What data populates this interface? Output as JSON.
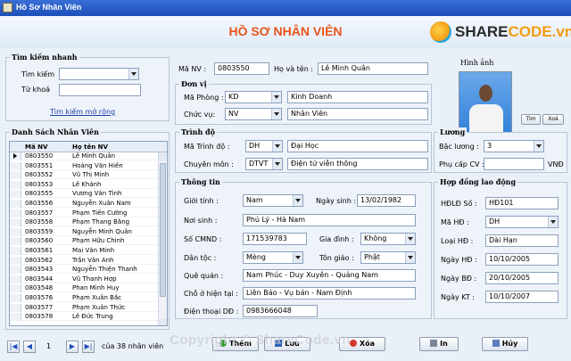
{
  "window": {
    "title": "Hồ Sơ Nhân Viên"
  },
  "header": {
    "title": "HỒ SƠ NHÂN VIÊN"
  },
  "logo": {
    "text_part1": "SHARE",
    "text_part2": "CODE.vn"
  },
  "search": {
    "group_title": "Tìm kiếm nhanh",
    "find_label": "Tìm kiếm",
    "find_value": "",
    "keyword_label": "Từ khoá",
    "keyword_value": "",
    "advanced_link": "Tìm kiếm mở rộng"
  },
  "employee_list": {
    "group_title": "Danh Sách Nhân Viên",
    "columns": [
      "Mã NV",
      "Họ tên NV"
    ],
    "rows": [
      [
        "0803550",
        "Lê Minh Quân"
      ],
      [
        "0803551",
        "Hoàng Văn Hiền"
      ],
      [
        "0803552",
        "Vũ Thị Minh"
      ],
      [
        "0803553",
        "Lê Khánh"
      ],
      [
        "0803555",
        "Vương Văn Tình"
      ],
      [
        "0803556",
        "Nguyễn Xuân Nam"
      ],
      [
        "0803557",
        "Phạm Tiến Cường"
      ],
      [
        "0803558",
        "Phạm Thang Bằng"
      ],
      [
        "0803559",
        "Nguyễn Minh Quân"
      ],
      [
        "0803560",
        "Phạm Hữu Chinh"
      ],
      [
        "0803561",
        "Mai Văn Minh"
      ],
      [
        "0803562",
        "Trần Văn Anh"
      ],
      [
        "0803543",
        "Nguyễn Thiện Thanh"
      ],
      [
        "0803544",
        "Vũ Thanh Hợp"
      ],
      [
        "0803548",
        "Phan Minh Huy"
      ],
      [
        "0803576",
        "Phạm Xuân Bắc"
      ],
      [
        "0803577",
        "Phạm Xuân Thức"
      ],
      [
        "0803578",
        "Lê Đức Trung"
      ]
    ]
  },
  "pager": {
    "first": "|◀",
    "prev": "◀",
    "current": "1",
    "next": "▶",
    "last": "▶|",
    "total_text": "của 38 nhân viên"
  },
  "top_fields": {
    "id_label": "Mã NV :",
    "id_value": "0803550",
    "name_label": "Họ và tên :",
    "name_value": "Lê Minh Quân"
  },
  "unit": {
    "group_title": "Đơn vị",
    "dept_label": "Mã Phòng :",
    "dept_code": "KD",
    "dept_name": "Kinh Doanh",
    "position_label": "Chức vụ:",
    "position_code": "NV",
    "position_name": "Nhân Viên"
  },
  "education": {
    "group_title": "Trình độ",
    "level_label": "Mã Trình độ :",
    "level_code": "DH",
    "level_name": "Đại Học",
    "major_label": "Chuyên môn :",
    "major_code": "DTVT",
    "major_name": "Điện tử viễn thông"
  },
  "info": {
    "group_title": "Thông tin",
    "gender_label": "Giới tính :",
    "gender_value": "Nam",
    "dob_label": "Ngày sinh :",
    "dob_value": "13/02/1982",
    "birthplace_label": "Nơi sinh :",
    "birthplace_value": "Phủ Lý - Hà Nam",
    "id_card_label": "Số CMND :",
    "id_card_value": "171539783",
    "family_label": "Gia đình :",
    "family_value": "Không",
    "ethnic_label": "Dân tộc :",
    "ethnic_value": "Mèng",
    "religion_label": "Tôn giáo :",
    "religion_value": "Phật",
    "hometown_label": "Quê quán :",
    "hometown_value": "Nam Phúc - Duy Xuyên - Quảng Nam",
    "address_label": "Chỗ ở hiện tại :",
    "address_value": "Liên Bảo - Vụ bản - Nam Định",
    "phone_label": "Điện thoại DĐ :",
    "phone_value": "0983666048"
  },
  "photo": {
    "group_title": "Hình ảnh",
    "search_btn": "Tìm",
    "delete_btn": "Xoá"
  },
  "salary": {
    "group_title": "Lương",
    "grade_label": "Bậc lương :",
    "grade_value": "3",
    "allowance_label": "Phụ cấp CV :",
    "allowance_value": "",
    "currency": "VNĐ"
  },
  "contract": {
    "group_title": "Hợp đồng lao động",
    "no_label": "HĐLĐ Số :",
    "no_value": "HĐ101",
    "code_label": "Mã HĐ :",
    "code_value": "DH",
    "type_label": "Loại HĐ :",
    "type_value": "Dài Hạn",
    "sign_label": "Ngày HĐ :",
    "sign_value": "10/10/2005",
    "start_label": "Ngày BĐ :",
    "start_value": "20/10/2005",
    "end_label": "Ngày KT :",
    "end_value": "10/10/2007"
  },
  "actions": {
    "add": "Thêm",
    "save": "Lưu",
    "delete": "Xóa",
    "print": "In",
    "cancel": "Hủy"
  },
  "watermark": "Copyright © ShareCode.vn"
}
